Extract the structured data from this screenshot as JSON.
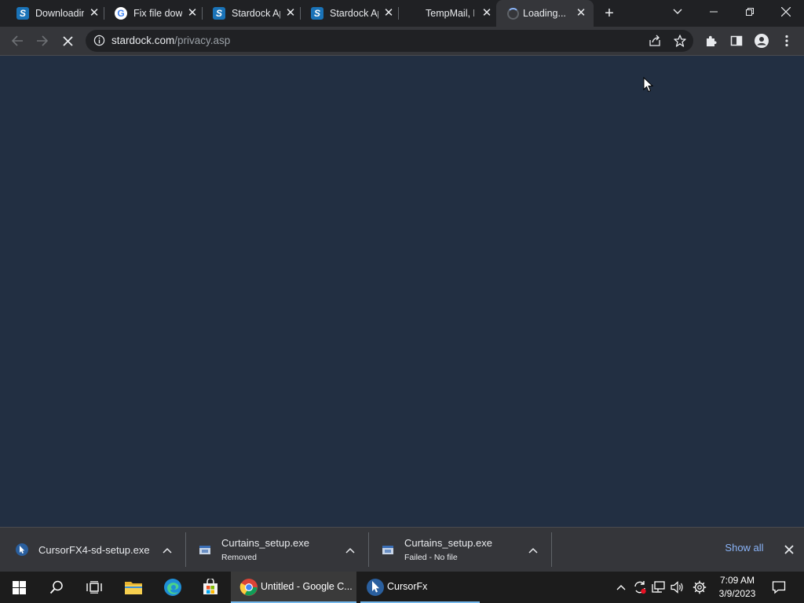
{
  "tabs": [
    {
      "title": "Downloading",
      "favicon": "stardock-icon"
    },
    {
      "title": "Fix file download",
      "favicon": "google-icon"
    },
    {
      "title": "Stardock Application",
      "favicon": "stardock-icon"
    },
    {
      "title": "Stardock Application",
      "favicon": "stardock-icon"
    },
    {
      "title": "TempMail, Free",
      "favicon": "none"
    },
    {
      "title": "Loading...",
      "favicon": "loading-spinner-icon",
      "active": true
    }
  ],
  "omnibox": {
    "host": "stardock.com",
    "path": "/privacy.asp"
  },
  "colors": {
    "content_bg": "#222f42",
    "chrome_frame": "#202124",
    "toolbar": "#35363a",
    "accent_link": "#8ab4f8"
  },
  "downloads": [
    {
      "name": "CursorFX4-sd-setup.exe",
      "status": ""
    },
    {
      "name": "Curtains_setup.exe",
      "status": "Removed"
    },
    {
      "name": "Curtains_setup.exe",
      "status": "Failed - No file"
    }
  ],
  "shelf": {
    "show_all": "Show all"
  },
  "taskbar": {
    "apps": [
      {
        "label": "Untitled - Google C..."
      },
      {
        "label": "CursorFx"
      }
    ],
    "clock": {
      "time": "7:09 AM",
      "date": "3/9/2023"
    }
  }
}
